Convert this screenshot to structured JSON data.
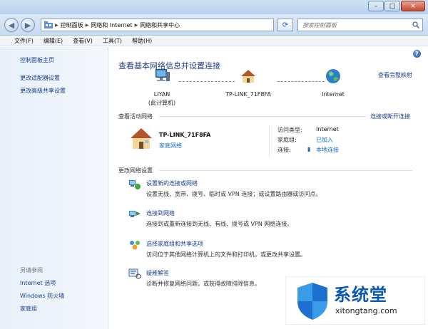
{
  "window": {
    "controls": {
      "minimize": "–",
      "maximize": "□",
      "close": "×"
    }
  },
  "address_bar": {
    "breadcrumbs": [
      "控制面板",
      "网络和 Internet",
      "网络和共享中心"
    ],
    "search_placeholder": "搜索控制面板"
  },
  "menu": [
    "文件(F)",
    "编辑(E)",
    "查看(V)",
    "工具(T)",
    "帮助(H)"
  ],
  "sidebar": {
    "items": [
      {
        "label": "控制面板主页"
      },
      {
        "label": "更改适配器设置"
      },
      {
        "label": "更改高级共享设置"
      }
    ],
    "see_also_title": "另请参阅",
    "see_also": [
      {
        "label": "Internet 选项"
      },
      {
        "label": "Windows 防火墙"
      },
      {
        "label": "家庭组"
      }
    ]
  },
  "main": {
    "title": "查看基本网络信息并设置连接",
    "full_map_link": "查看完整映射",
    "map": {
      "computer_name": "LIYAN",
      "computer_sub": "(此计算机)",
      "router_name": "TP-LINK_71F8FA",
      "internet_name": "Internet"
    },
    "active_networks_title": "查看活动网络",
    "connect_link": "连接或断开连接",
    "active_network": {
      "name": "TP-LINK_71F8FA",
      "type": "家庭网络",
      "access_type_label": "访问类型:",
      "access_type_value": "Internet",
      "homegroup_label": "家庭组:",
      "homegroup_value": "已加入",
      "connection_label": "连接:",
      "connection_value": "本地连接"
    },
    "change_settings_title": "更改网络设置",
    "tasks": [
      {
        "title": "设置新的连接或网络",
        "desc": "设置无线、宽带、拨号、临时或 VPN 连接；或设置路由器或访问点。"
      },
      {
        "title": "连接到网络",
        "desc": "连接到或重新连接到无线、有线、拨号或 VPN 网络连接。"
      },
      {
        "title": "选择家庭组和共享选项",
        "desc": "访问位于其他网络计算机上的文件和打印机，或更改共享设置。"
      },
      {
        "title": "疑难解答",
        "desc": "诊断并修复网络问题，或获得故障排除信息。"
      }
    ]
  },
  "watermark": {
    "brand": "系统堂",
    "url": "xitongtang.com"
  },
  "colors": {
    "link": "#1a3d8a",
    "title": "#1f3f87",
    "accent": "#0a58b4"
  }
}
